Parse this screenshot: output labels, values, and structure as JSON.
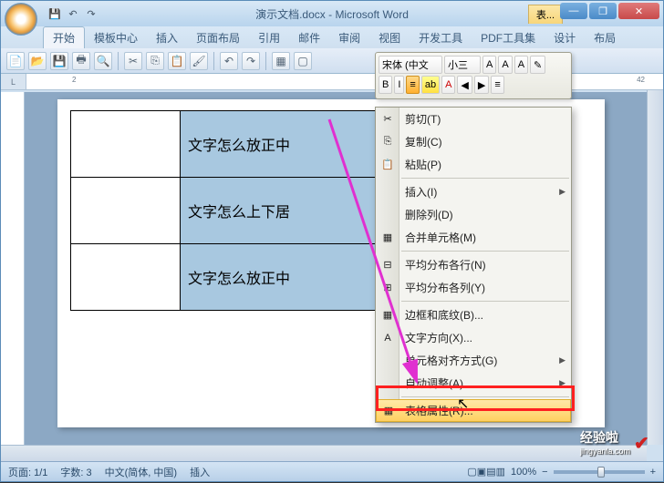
{
  "title": "演示文档.docx - Microsoft Word",
  "extra_tab": "表...",
  "win": {
    "min": "—",
    "max": "❐",
    "close": "✕"
  },
  "tabs": [
    "开始",
    "模板中心",
    "插入",
    "页面布局",
    "引用",
    "邮件",
    "审阅",
    "视图",
    "开发工具",
    "PDF工具集",
    "设计",
    "布局"
  ],
  "ruler_corner": "L",
  "ruler_marks": {
    "m2": "2",
    "m42": "42"
  },
  "table_rows": [
    {
      "text": "文字怎么放正中"
    },
    {
      "text": "文字怎么上下居"
    },
    {
      "text": "文字怎么放正中"
    }
  ],
  "mini_toolbar": {
    "font": "宋体 (中文",
    "size": "小三",
    "grow": "A",
    "shrink": "A",
    "styleA": "A",
    "brush": "✎",
    "bold": "B",
    "italic": "I",
    "align": "≡",
    "highlight": "ab",
    "fontcolor": "A",
    "indent_dec": "◀",
    "indent_inc": "▶",
    "list": "≡"
  },
  "context_menu": {
    "cut": "剪切(T)",
    "copy": "复制(C)",
    "paste": "粘贴(P)",
    "insert": "插入(I)",
    "delete_col": "删除列(D)",
    "merge": "合并单元格(M)",
    "dist_rows": "平均分布各行(N)",
    "dist_cols": "平均分布各列(Y)",
    "borders": "边框和底纹(B)...",
    "text_dir": "文字方向(X)...",
    "cell_align": "单元格对齐方式(G)",
    "autofit": "自动调整(A)",
    "table_props": "表格属性(R)..."
  },
  "icons": {
    "cut": "✂",
    "copy": "⎘",
    "paste": "📋",
    "merge": "▦",
    "dist_rows": "⊟",
    "dist_cols": "⊞",
    "borders": "▦",
    "text_dir": "A",
    "table_props": "▦"
  },
  "status": {
    "page": "页面: 1/1",
    "words": "字数: 3",
    "lang": "中文(简体, 中国)",
    "insert": "插入",
    "zoom": "100%",
    "minus": "−",
    "plus": "+"
  },
  "watermark": {
    "brand": "经验啦",
    "domain": "jingyanla.com",
    "check": "✔"
  }
}
